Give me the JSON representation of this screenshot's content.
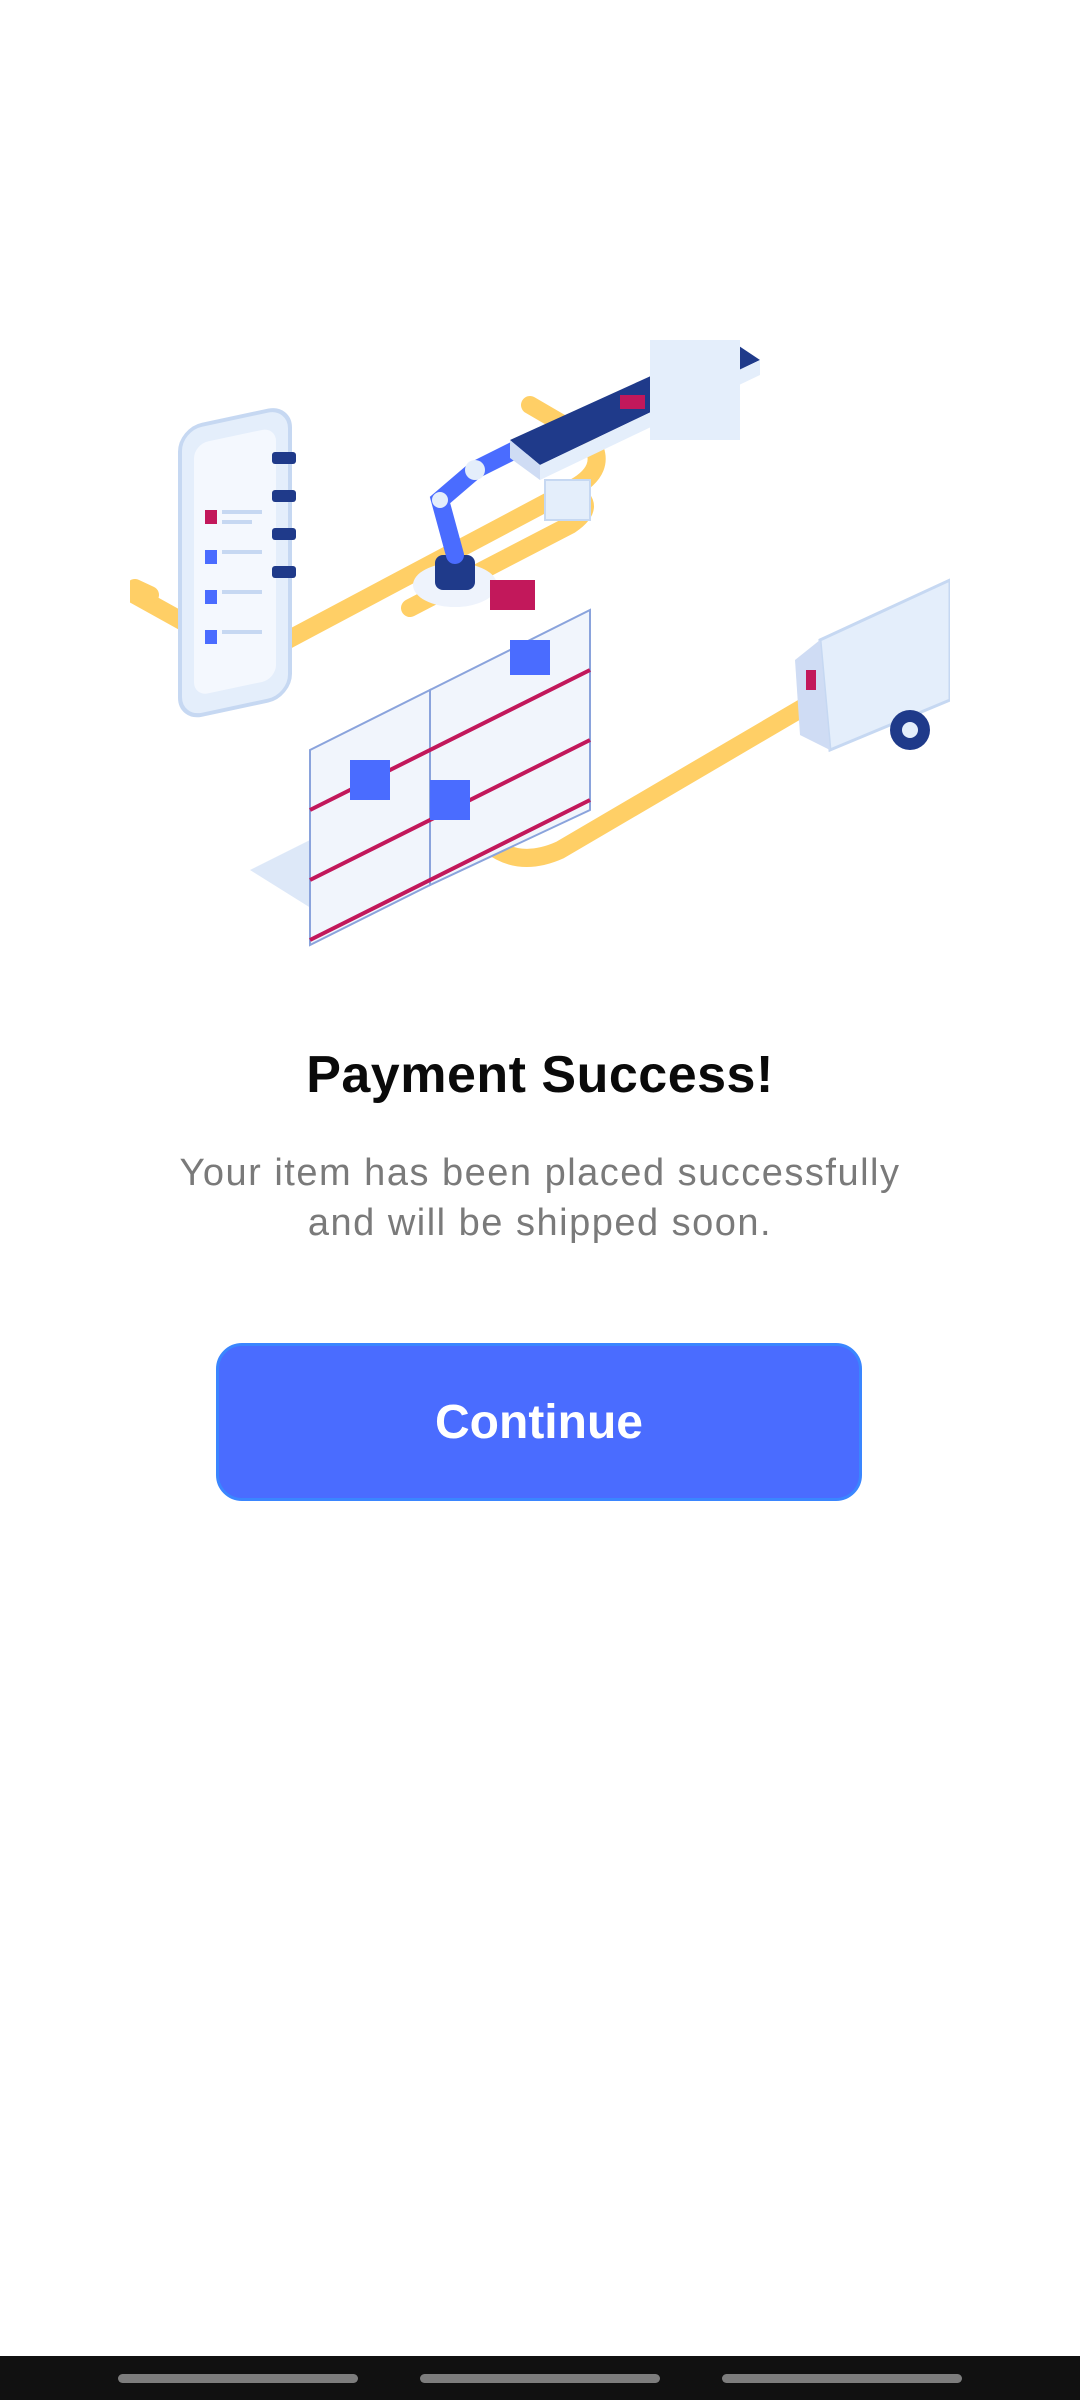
{
  "screen": {
    "title": "Payment Success!",
    "message_line1": "Your item has been placed successfully",
    "message_line2": "and will be shipped soon.",
    "continue_label": "Continue"
  },
  "illustration": {
    "icon": "warehouse-shipping-illustration"
  },
  "colors": {
    "accent": "#4a6cff",
    "accent_border": "#3a86ff",
    "title": "#0a0a0a",
    "message": "#7a7a7a",
    "path": "#ffcf66",
    "navy": "#1f3a8a",
    "magenta": "#c2185b"
  }
}
